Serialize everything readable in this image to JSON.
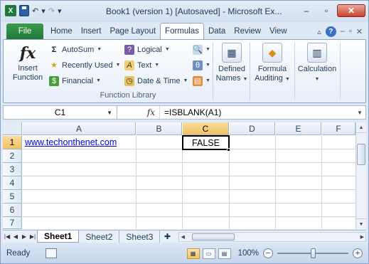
{
  "window": {
    "title": "Book1 (version 1) [Autosaved] - Microsoft Ex...",
    "app_icon": "X",
    "controls": [
      "–",
      "▫",
      "✕"
    ]
  },
  "quick_access": {
    "undo": "↶",
    "redo": "↷",
    "dropdown": "▾"
  },
  "ribbon_tabs": [
    "File",
    "Home",
    "Insert",
    "Page Layout",
    "Formulas",
    "Data",
    "Review",
    "View"
  ],
  "active_tab": "Formulas",
  "ribbon_right": {
    "minimize": "▵",
    "help": "?",
    "min": "–",
    "restore": "▫",
    "close": "✕"
  },
  "function_library": {
    "insert_function": {
      "icon": "fx",
      "label_line1": "Insert",
      "label_line2": "Function"
    },
    "col1": [
      {
        "icon": "Σ",
        "label": "AutoSum"
      },
      {
        "icon": "★",
        "label": "Recently Used"
      },
      {
        "icon": "$",
        "label": "Financial"
      }
    ],
    "col2": [
      {
        "icon": "?",
        "label": "Logical"
      },
      {
        "icon": "A",
        "label": "Text"
      },
      {
        "icon": "◷",
        "label": "Date & Time"
      }
    ],
    "group_label": "Function Library"
  },
  "defined_names": {
    "line1": "Defined",
    "line2": "Names"
  },
  "formula_auditing": {
    "line1": "Formula",
    "line2": "Auditing"
  },
  "calculation": {
    "line1": "Calculation"
  },
  "formula_bar": {
    "name_box": "C1",
    "fx": "fx",
    "formula": "=ISBLANK(A1)"
  },
  "columns": [
    "A",
    "B",
    "C",
    "D",
    "E",
    "F"
  ],
  "rows": [
    "1",
    "2",
    "3",
    "4",
    "5",
    "6",
    "7"
  ],
  "cells": {
    "A1": "www.techonthenet.com",
    "C1": "FALSE"
  },
  "selected_cell": "C1",
  "sheets": [
    "Sheet1",
    "Sheet2",
    "Sheet3"
  ],
  "active_sheet": "Sheet1",
  "status": {
    "mode": "Ready",
    "zoom": "100%",
    "zoom_percent": 100
  }
}
